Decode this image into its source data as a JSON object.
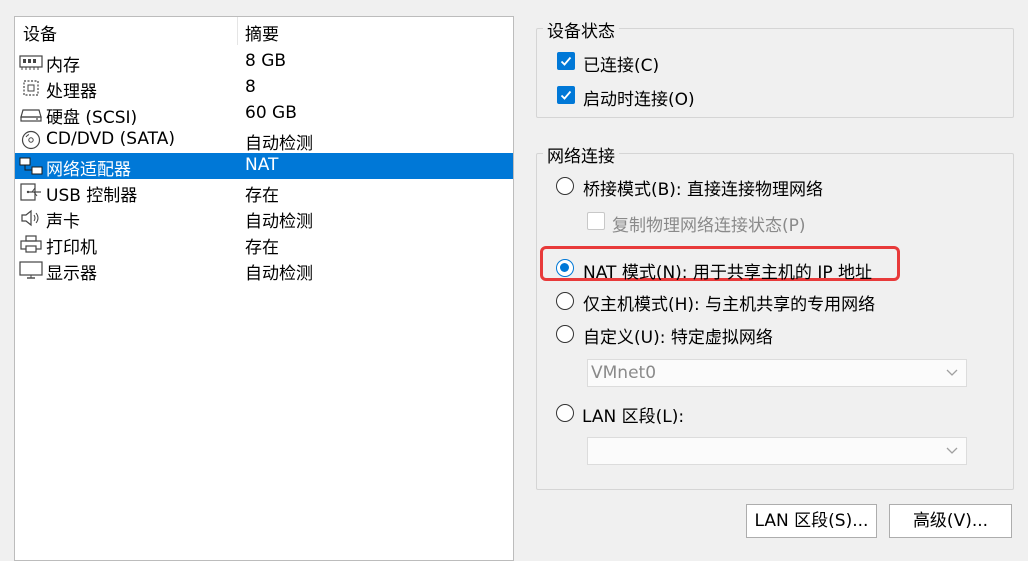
{
  "device_list": {
    "header": {
      "device": "设备",
      "summary": "摘要"
    },
    "rows": [
      {
        "icon": "memory-icon",
        "name": "内存",
        "summary": "8 GB"
      },
      {
        "icon": "cpu-icon",
        "name": "处理器",
        "summary": "8"
      },
      {
        "icon": "harddisk-icon",
        "name": "硬盘 (SCSI)",
        "summary": "60 GB"
      },
      {
        "icon": "cd-dvd-icon",
        "name": "CD/DVD (SATA)",
        "summary": "自动检测"
      },
      {
        "icon": "network-adapter-icon",
        "name": "网络适配器",
        "summary": "NAT"
      },
      {
        "icon": "usb-icon",
        "name": "USB 控制器",
        "summary": "存在"
      },
      {
        "icon": "sound-icon",
        "name": "声卡",
        "summary": "自动检测"
      },
      {
        "icon": "printer-icon",
        "name": "打印机",
        "summary": "存在"
      },
      {
        "icon": "display-icon",
        "name": "显示器",
        "summary": "自动检测"
      }
    ],
    "selected_index": 4
  },
  "device_status": {
    "title": "设备状态",
    "connected": {
      "label": "已连接(C)",
      "checked": true
    },
    "connect_at_power_on": {
      "label": "启动时连接(O)",
      "checked": true
    }
  },
  "network_connection": {
    "title": "网络连接",
    "bridged": {
      "label": "桥接模式(B): 直接连接物理网络",
      "selected": false
    },
    "replicate": {
      "label": "复制物理网络连接状态(P)",
      "checked": false,
      "enabled": false
    },
    "nat": {
      "label": "NAT 模式(N): 用于共享主机的 IP 地址",
      "selected": true
    },
    "host_only": {
      "label": "仅主机模式(H): 与主机共享的专用网络",
      "selected": false
    },
    "custom": {
      "label": "自定义(U): 特定虚拟网络",
      "selected": false
    },
    "custom_select": {
      "value": "VMnet0"
    },
    "lan_segment": {
      "label": "LAN 区段(L):",
      "selected": false
    },
    "lan_select": {
      "value": ""
    }
  },
  "buttons": {
    "lan_segments": "LAN 区段(S)...",
    "advanced": "高级(V)..."
  },
  "colors": {
    "selection": "#0078d7",
    "highlight": "#e83a3a"
  }
}
